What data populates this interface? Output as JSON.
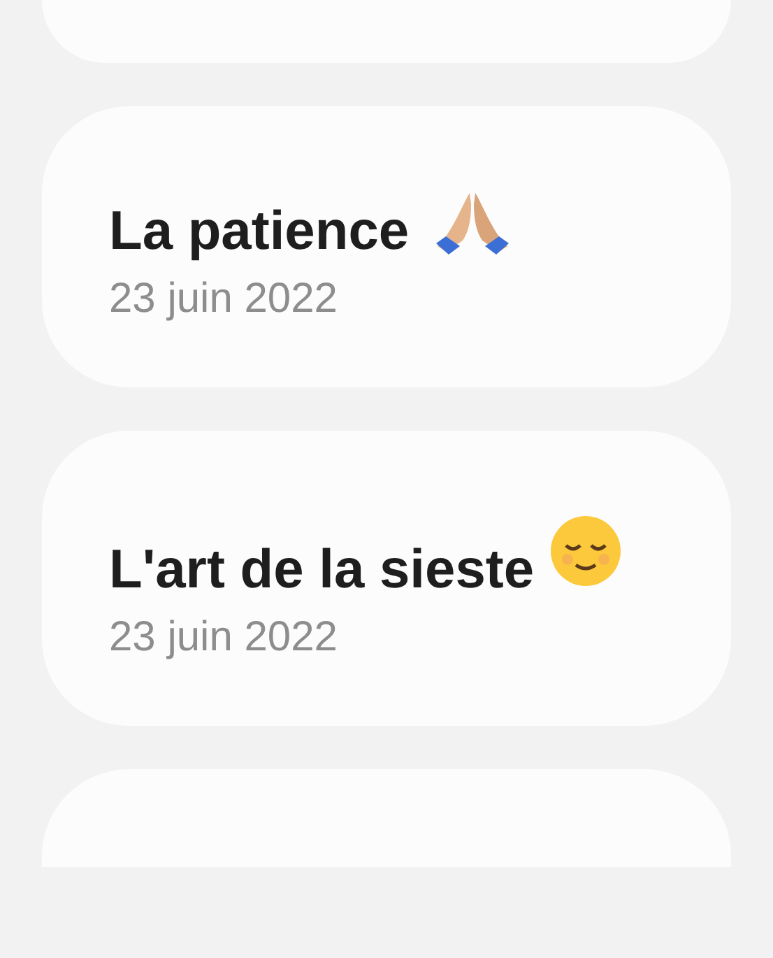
{
  "notes": [
    {
      "kind": "partial-top"
    },
    {
      "kind": "note",
      "title": "La patience",
      "icon": {
        "kind": "pray"
      },
      "date": "23 juin 2022"
    },
    {
      "kind": "note",
      "title": "L'art de la sieste",
      "icon": {
        "kind": "relieved"
      },
      "date": "23 juin 2022"
    },
    {
      "kind": "partial-bottom"
    }
  ]
}
